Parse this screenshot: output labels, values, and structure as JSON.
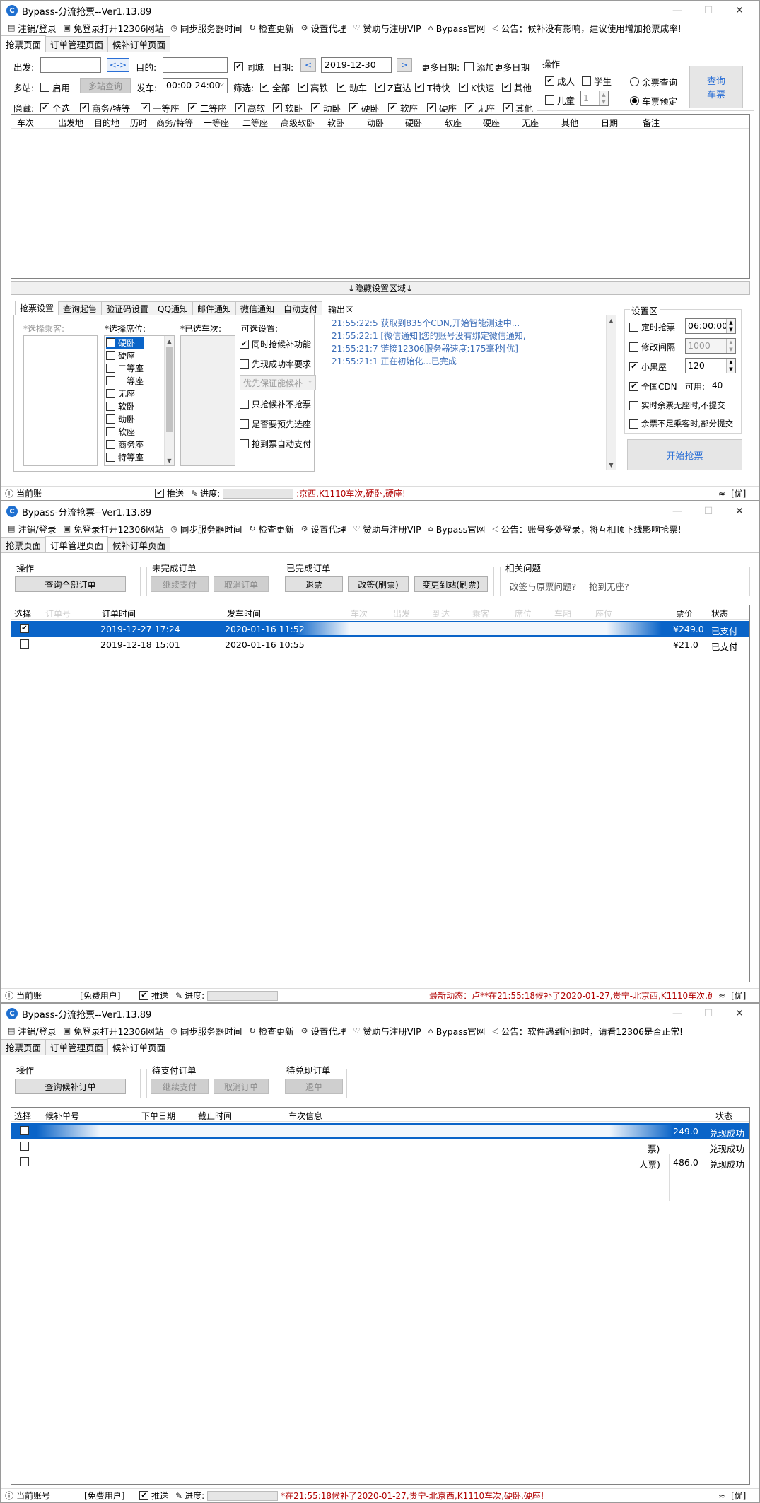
{
  "app": {
    "title": "Bypass-分流抢票--Ver1.13.89",
    "icon": "C",
    "controls": {
      "minimize": "—",
      "maximize": "☐",
      "close": "✕"
    }
  },
  "menu": [
    {
      "icon": "logout-icon",
      "glyph": "▤",
      "label": "注销/登录"
    },
    {
      "icon": "window-icon",
      "glyph": "▣",
      "label": "免登录打开12306网站"
    },
    {
      "icon": "clock-icon",
      "glyph": "◷",
      "label": "同步服务器时间"
    },
    {
      "icon": "refresh-icon",
      "glyph": "↻",
      "label": "检查更新"
    },
    {
      "icon": "gear-icon",
      "glyph": "⚙",
      "label": "设置代理"
    },
    {
      "icon": "heart-icon",
      "glyph": "♡",
      "label": "赞助与注册VIP"
    },
    {
      "icon": "home-icon",
      "glyph": "⌂",
      "label": "Bypass官网"
    },
    {
      "icon": "speaker-icon",
      "glyph": "◁",
      "label": ""
    }
  ],
  "tabs": [
    "抢票页面",
    "订单管理页面",
    "候补订单页面"
  ],
  "win1": {
    "notice": "公告：候补没有影响，建议使用增加抢票成率!",
    "from_label": "出发:",
    "swap": "<->",
    "to_label": "目的:",
    "same_city": "同城",
    "date_label": "日期:",
    "date_value": "2019-12-30",
    "prev": "<",
    "next": ">",
    "more_dates_label": "更多日期:",
    "more_dates": "添加更多日期",
    "multi_label": "多站:",
    "enable": "启用",
    "multi_query": "多站查询",
    "depart_label": "发车:",
    "depart_value": "00:00-24:00",
    "filter_label": "筛选:",
    "filters": [
      "全部",
      "高铁",
      "动车",
      "Z直达",
      "T特快",
      "K快速",
      "其他"
    ],
    "hide_label": "隐藏:",
    "hides": [
      "全选",
      "商务/特等",
      "一等座",
      "二等座",
      "高软",
      "软卧",
      "动卧",
      "硬卧",
      "软座",
      "硬座",
      "无座",
      "其他"
    ],
    "ops": {
      "title": "操作",
      "adult": "成人",
      "student": "学生",
      "child": "儿童",
      "child_count": "1",
      "remain": "余票查询",
      "reserve": "车票预定",
      "query_btn_1": "查询",
      "query_btn_2": "车票"
    },
    "grid_headers": [
      "车次",
      "出发地",
      "目的地",
      "历时",
      "商务/特等",
      "一等座",
      "二等座",
      "高级软卧",
      "软卧",
      "动卧",
      "硬卧",
      "软座",
      "硬座",
      "无座",
      "其他",
      "日期",
      "备注"
    ],
    "hide_region": "↓隐藏设置区域↓",
    "sub_tabs": [
      "抢票设置",
      "查询起售",
      "验证码设置",
      "QQ通知",
      "邮件通知",
      "微信通知",
      "自动支付"
    ],
    "choose_passenger": "*选择乘客:",
    "choose_seat": "*选择席位:",
    "seats": [
      "硬卧",
      "硬座",
      "二等座",
      "一等座",
      "无座",
      "软卧",
      "动卧",
      "软座",
      "商务座",
      "特等座"
    ],
    "chosen_train": "*已选车次:",
    "optional": "可选设置:",
    "opt_items": [
      "同时抢候补功能",
      "先现成功率要求",
      "只抢候补不抢票",
      "是否要预先选座",
      "抢到票自动支付"
    ],
    "opt_select": "优先保证能候补",
    "output_label": "输出区",
    "logs": [
      "21:55:22:5   获取到835个CDN,开始智能测速中...",
      "21:55:22:1   [微信通知]您的账号没有绑定微信通知,",
      "21:55:21:7   链接12306服务器速度:175毫秒[优]",
      "21:55:21:1   正在初始化...已完成"
    ],
    "settings": {
      "title": "设置区",
      "timer": "定时抢票",
      "timer_value": "06:00:00",
      "interval": "修改间隔",
      "interval_value": "1000",
      "blackroom": "小黑屋",
      "blackroom_value": "120",
      "cdn": "全国CDN",
      "cdn_avail": "可用:",
      "cdn_count": "40",
      "realtime": "实时余票无座时,不提交",
      "partial": "余票不足乘客时,部分提交"
    },
    "start_btn": "开始抢票",
    "status_left": "当前账",
    "push": "推送",
    "progress": "进度:",
    "status_msg": ":京西,K1110车次,硬卧,硬座!",
    "wifi": "[优]"
  },
  "win2": {
    "notice": "公告：账号多处登录，将互相顶下线影响抢票!",
    "ops_title": "操作",
    "query_all": "查询全部订单",
    "unfinished_title": "未完成订单",
    "continue_pay": "继续支付",
    "cancel_order": "取消订单",
    "finished_title": "已完成订单",
    "refund": "退票",
    "change": "改签(刷票)",
    "change_station": "变更到站(刷票)",
    "faq_title": "相关问题",
    "faq1": "改签与原票问题?",
    "faq2": "抢到无座?",
    "grid_headers": [
      "选择",
      "订单号",
      "订单时间",
      "发车时间",
      "车次",
      "出发",
      "到达",
      "乘客",
      "席位",
      "车厢",
      "座位",
      "票价",
      "状态"
    ],
    "rows": [
      {
        "checked": true,
        "order_time": "2019-12-27 17:24",
        "depart": "2020-01-16 11:52",
        "price": "¥249.0",
        "state": "已支付"
      },
      {
        "checked": false,
        "order_time": "2019-12-18 15:01",
        "depart": "2020-01-16 10:55",
        "price": "¥21.0",
        "state": "已支付"
      }
    ],
    "status_left": "当前账",
    "user_type": "[免费用户]",
    "push": "推送",
    "progress": "进度:",
    "status_msg": "最新动态：卢**在21:55:18候补了2020-01-27,贵宁-北京西,K1110车次,硬",
    "wifi": "[优]"
  },
  "win3": {
    "notice": "公告：软件遇到问题时，请看12306是否正常!",
    "ops_title": "操作",
    "query_btn": "查询候补订单",
    "pending_title": "待支付订单",
    "continue_pay": "继续支付",
    "cancel_order": "取消订单",
    "redeem_title": "待兑现订单",
    "refund": "退单",
    "grid_headers": [
      "选择",
      "候补单号",
      "下单日期",
      "截止时间",
      "车次信息",
      "",
      "状态"
    ],
    "rows": [
      {
        "checked": false,
        "info": "",
        "price": "249.0",
        "state": "兑现成功"
      },
      {
        "checked": false,
        "info": "票)",
        "price": "",
        "state": "兑现成功"
      },
      {
        "checked": false,
        "info": "人票)",
        "price": "486.0",
        "state": "兑现成功"
      }
    ],
    "status_left": "当前账号",
    "user_type": "[免费用户]",
    "push": "推送",
    "progress": "进度:",
    "status_msg": "*在21:55:18候补了2020-01-27,贵宁-北京西,K1110车次,硬卧,硬座!",
    "wifi": "[优]"
  }
}
